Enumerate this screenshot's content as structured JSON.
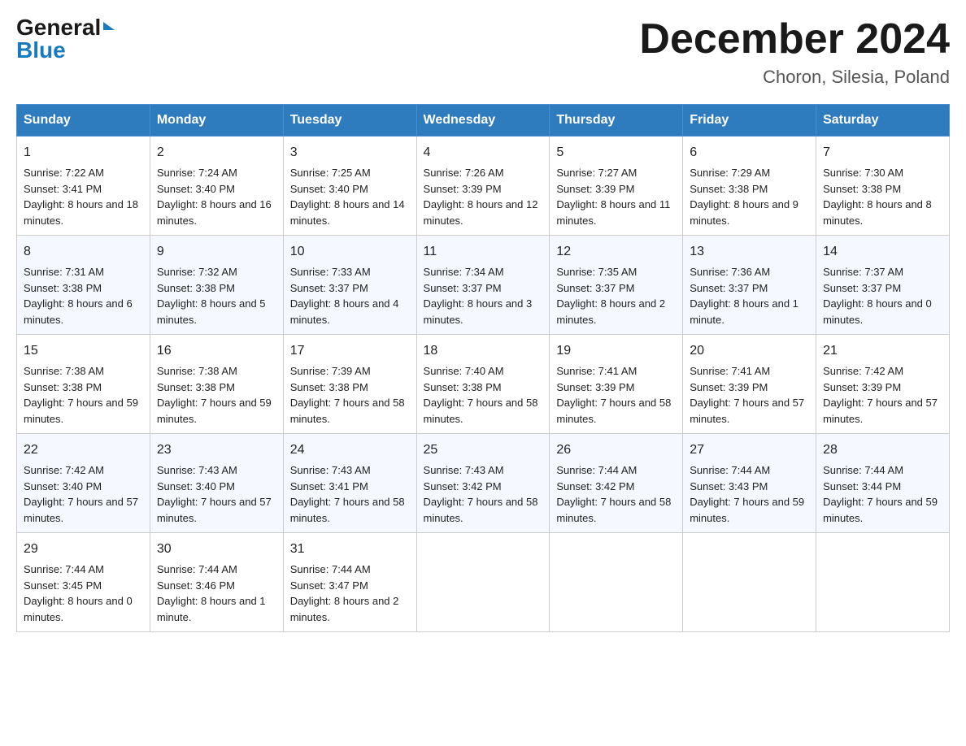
{
  "header": {
    "logo_general": "General",
    "logo_blue": "Blue",
    "month_title": "December 2024",
    "location": "Choron, Silesia, Poland"
  },
  "days_of_week": [
    "Sunday",
    "Monday",
    "Tuesday",
    "Wednesday",
    "Thursday",
    "Friday",
    "Saturday"
  ],
  "weeks": [
    [
      {
        "day": "1",
        "sunrise": "7:22 AM",
        "sunset": "3:41 PM",
        "daylight": "8 hours and 18 minutes."
      },
      {
        "day": "2",
        "sunrise": "7:24 AM",
        "sunset": "3:40 PM",
        "daylight": "8 hours and 16 minutes."
      },
      {
        "day": "3",
        "sunrise": "7:25 AM",
        "sunset": "3:40 PM",
        "daylight": "8 hours and 14 minutes."
      },
      {
        "day": "4",
        "sunrise": "7:26 AM",
        "sunset": "3:39 PM",
        "daylight": "8 hours and 12 minutes."
      },
      {
        "day": "5",
        "sunrise": "7:27 AM",
        "sunset": "3:39 PM",
        "daylight": "8 hours and 11 minutes."
      },
      {
        "day": "6",
        "sunrise": "7:29 AM",
        "sunset": "3:38 PM",
        "daylight": "8 hours and 9 minutes."
      },
      {
        "day": "7",
        "sunrise": "7:30 AM",
        "sunset": "3:38 PM",
        "daylight": "8 hours and 8 minutes."
      }
    ],
    [
      {
        "day": "8",
        "sunrise": "7:31 AM",
        "sunset": "3:38 PM",
        "daylight": "8 hours and 6 minutes."
      },
      {
        "day": "9",
        "sunrise": "7:32 AM",
        "sunset": "3:38 PM",
        "daylight": "8 hours and 5 minutes."
      },
      {
        "day": "10",
        "sunrise": "7:33 AM",
        "sunset": "3:37 PM",
        "daylight": "8 hours and 4 minutes."
      },
      {
        "day": "11",
        "sunrise": "7:34 AM",
        "sunset": "3:37 PM",
        "daylight": "8 hours and 3 minutes."
      },
      {
        "day": "12",
        "sunrise": "7:35 AM",
        "sunset": "3:37 PM",
        "daylight": "8 hours and 2 minutes."
      },
      {
        "day": "13",
        "sunrise": "7:36 AM",
        "sunset": "3:37 PM",
        "daylight": "8 hours and 1 minute."
      },
      {
        "day": "14",
        "sunrise": "7:37 AM",
        "sunset": "3:37 PM",
        "daylight": "8 hours and 0 minutes."
      }
    ],
    [
      {
        "day": "15",
        "sunrise": "7:38 AM",
        "sunset": "3:38 PM",
        "daylight": "7 hours and 59 minutes."
      },
      {
        "day": "16",
        "sunrise": "7:38 AM",
        "sunset": "3:38 PM",
        "daylight": "7 hours and 59 minutes."
      },
      {
        "day": "17",
        "sunrise": "7:39 AM",
        "sunset": "3:38 PM",
        "daylight": "7 hours and 58 minutes."
      },
      {
        "day": "18",
        "sunrise": "7:40 AM",
        "sunset": "3:38 PM",
        "daylight": "7 hours and 58 minutes."
      },
      {
        "day": "19",
        "sunrise": "7:41 AM",
        "sunset": "3:39 PM",
        "daylight": "7 hours and 58 minutes."
      },
      {
        "day": "20",
        "sunrise": "7:41 AM",
        "sunset": "3:39 PM",
        "daylight": "7 hours and 57 minutes."
      },
      {
        "day": "21",
        "sunrise": "7:42 AM",
        "sunset": "3:39 PM",
        "daylight": "7 hours and 57 minutes."
      }
    ],
    [
      {
        "day": "22",
        "sunrise": "7:42 AM",
        "sunset": "3:40 PM",
        "daylight": "7 hours and 57 minutes."
      },
      {
        "day": "23",
        "sunrise": "7:43 AM",
        "sunset": "3:40 PM",
        "daylight": "7 hours and 57 minutes."
      },
      {
        "day": "24",
        "sunrise": "7:43 AM",
        "sunset": "3:41 PM",
        "daylight": "7 hours and 58 minutes."
      },
      {
        "day": "25",
        "sunrise": "7:43 AM",
        "sunset": "3:42 PM",
        "daylight": "7 hours and 58 minutes."
      },
      {
        "day": "26",
        "sunrise": "7:44 AM",
        "sunset": "3:42 PM",
        "daylight": "7 hours and 58 minutes."
      },
      {
        "day": "27",
        "sunrise": "7:44 AM",
        "sunset": "3:43 PM",
        "daylight": "7 hours and 59 minutes."
      },
      {
        "day": "28",
        "sunrise": "7:44 AM",
        "sunset": "3:44 PM",
        "daylight": "7 hours and 59 minutes."
      }
    ],
    [
      {
        "day": "29",
        "sunrise": "7:44 AM",
        "sunset": "3:45 PM",
        "daylight": "8 hours and 0 minutes."
      },
      {
        "day": "30",
        "sunrise": "7:44 AM",
        "sunset": "3:46 PM",
        "daylight": "8 hours and 1 minute."
      },
      {
        "day": "31",
        "sunrise": "7:44 AM",
        "sunset": "3:47 PM",
        "daylight": "8 hours and 2 minutes."
      },
      null,
      null,
      null,
      null
    ]
  ],
  "labels": {
    "sunrise": "Sunrise:",
    "sunset": "Sunset:",
    "daylight": "Daylight:"
  }
}
